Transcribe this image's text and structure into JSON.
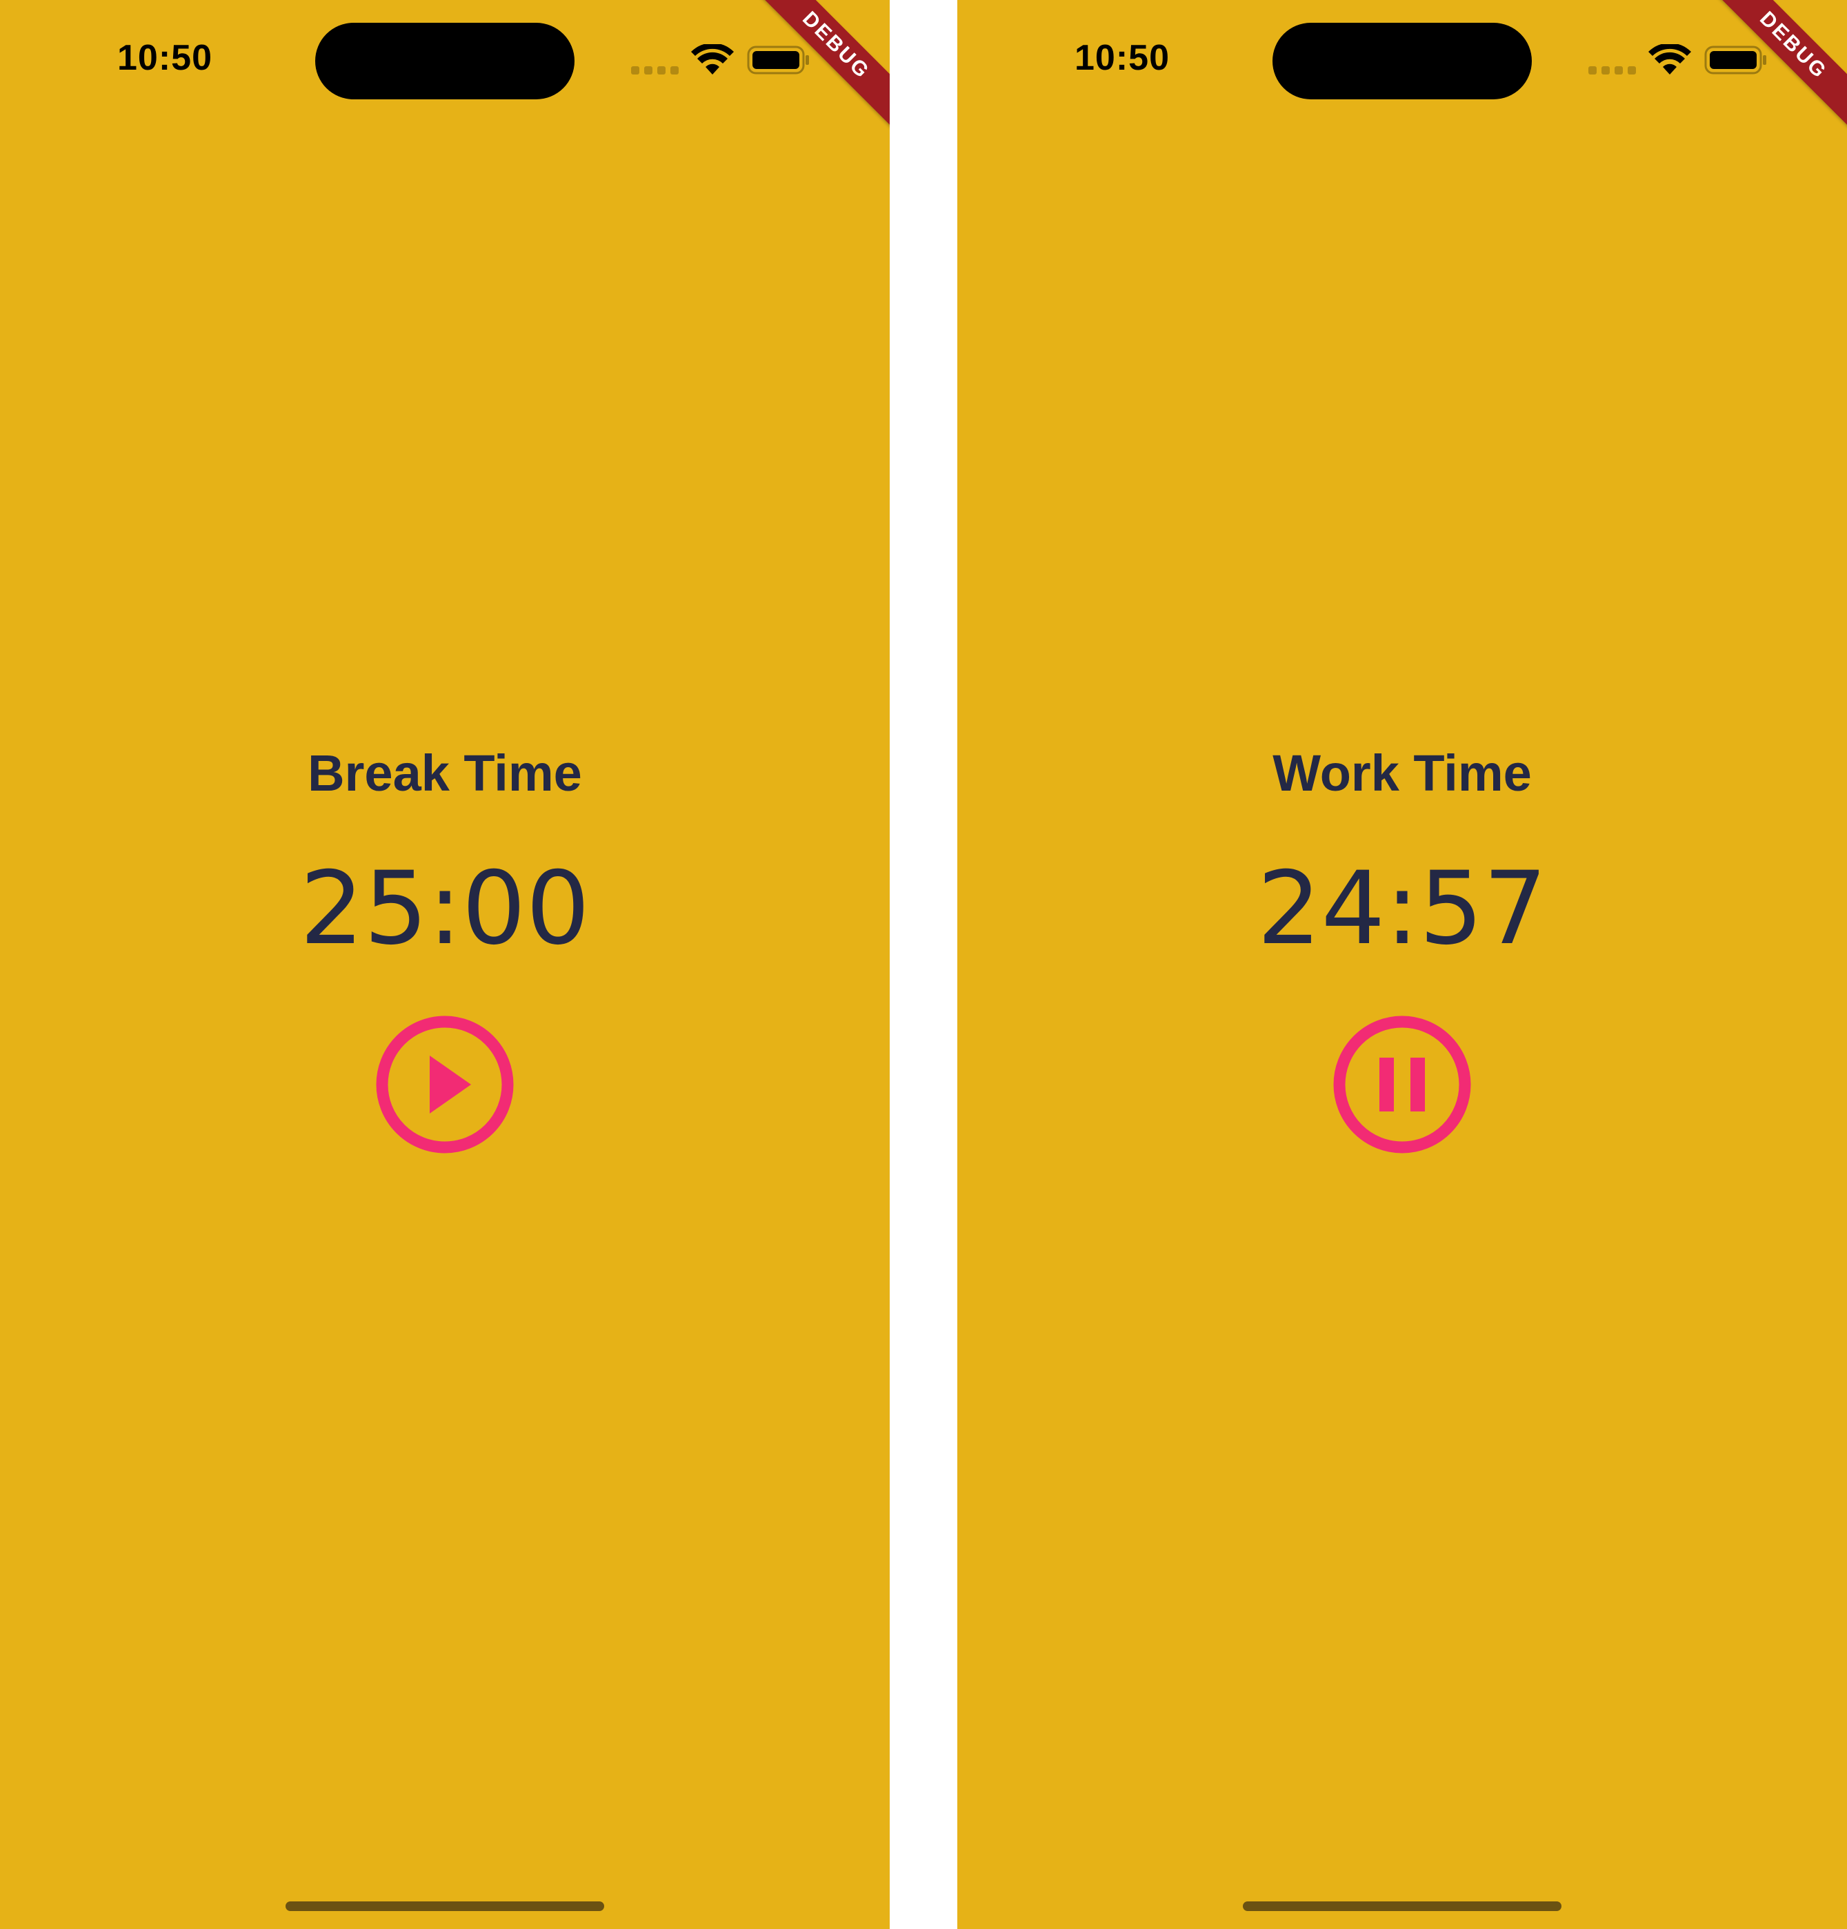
{
  "colors": {
    "background": "#E6B217",
    "text": "#232845",
    "accent": "#F22B74",
    "debug_banner": "#9F1D22"
  },
  "screens": [
    {
      "status_bar": {
        "time": "10:50",
        "icons": [
          "cellular-signal-icon",
          "wifi-icon",
          "battery-icon"
        ]
      },
      "debug_banner": "DEBUG",
      "mode_label": "Break Time",
      "timer": "25:00",
      "control_icon": "play-circle-icon"
    },
    {
      "status_bar": {
        "time": "10:50",
        "icons": [
          "cellular-signal-icon",
          "wifi-icon",
          "battery-icon"
        ]
      },
      "debug_banner": "DEBUG",
      "mode_label": "Work Time",
      "timer": "24:57",
      "control_icon": "pause-circle-icon"
    }
  ]
}
